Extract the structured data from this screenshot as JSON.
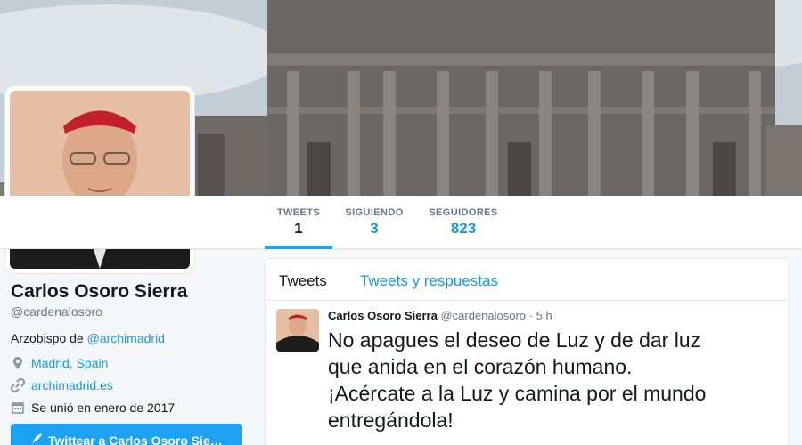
{
  "profile": {
    "full_name": "Carlos Osoro Sierra",
    "handle": "@cardenalosoro",
    "bio_prefix": "Arzobispo de ",
    "bio_link": "@archimadrid",
    "location": "Madrid, Spain",
    "website": "archimadrid.es",
    "joined": "Se unió en enero de 2017",
    "tweet_to_button": "Twittear a Carlos Osoro Sie…"
  },
  "nav": {
    "tweets_label": "TWEETS",
    "tweets_count": "1",
    "following_label": "SIGUIENDO",
    "following_count": "3",
    "followers_label": "SEGUIDORES",
    "followers_count": "823"
  },
  "timeline": {
    "tab_tweets": "Tweets",
    "tab_replies": "Tweets y respuestas",
    "tweet": {
      "name": "Carlos Osoro Sierra",
      "handle": "@cardenalosoro",
      "separator": "·",
      "time": "5 h",
      "text_lines": [
        "No apagues el deseo de Luz y de dar luz",
        "que anida en el corazón humano.",
        "¡Acércate a la Luz y camina por el mundo",
        "entregándola!"
      ]
    }
  },
  "colors": {
    "accent": "#1da1f2",
    "link": "#1b95e0",
    "text": "#14171a",
    "muted": "#657786"
  },
  "icons": {
    "location": "map-pin-icon",
    "website": "link-icon",
    "joined": "calendar-icon",
    "tweet_button": "feather-quill-icon"
  }
}
